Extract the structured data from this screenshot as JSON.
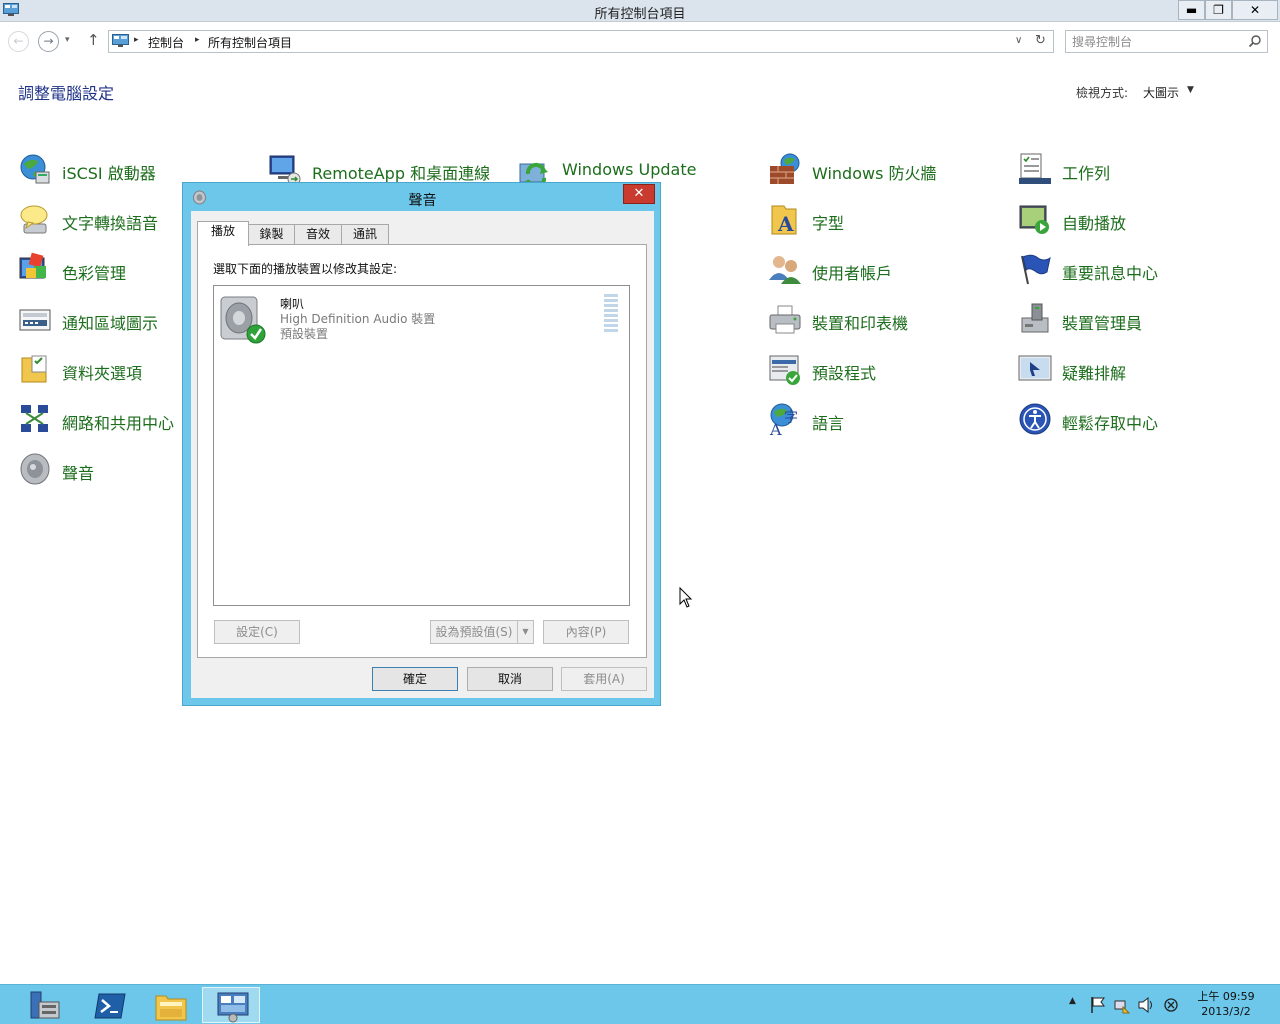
{
  "window": {
    "title": "所有控制台項目",
    "min_glyph": "▬",
    "max_glyph": "❐",
    "close_glyph": "✕"
  },
  "nav": {
    "back_glyph": "←",
    "forward_glyph": "→",
    "recent_glyph": "▾",
    "up_glyph": "↑",
    "breadcrumbs": [
      "控制台",
      "所有控制台項目"
    ],
    "crumb_sep": "▸",
    "dropdown_glyph": "∨",
    "refresh_glyph": "↻",
    "search_placeholder": "搜尋控制台"
  },
  "header": {
    "title": "調整電腦設定",
    "view_label": "檢視方式:",
    "view_value": "大圖示",
    "view_arrow": "▼"
  },
  "items": [
    {
      "label": "iSCSI 啟動器",
      "icon": "iscsi-globe-icon"
    },
    {
      "label": "RemoteApp 和桌面連線",
      "icon": "remoteapp-icon"
    },
    {
      "label": "Windows Update",
      "icon": "windows-update-icon"
    },
    {
      "label": "Windows 防火牆",
      "icon": "firewall-icon"
    },
    {
      "label": "工作列",
      "icon": "taskbar-icon"
    },
    {
      "label": "文字轉換語音",
      "icon": "speech-bubble-icon"
    },
    {
      "label": "字型",
      "icon": "font-folder-icon"
    },
    {
      "label": "自動播放",
      "icon": "autoplay-icon"
    },
    {
      "label": "色彩管理",
      "icon": "color-management-icon"
    },
    {
      "label": "使用者帳戶",
      "icon": "user-accounts-icon"
    },
    {
      "label": "重要訊息中心",
      "icon": "action-center-flag-icon"
    },
    {
      "label": "通知區域圖示",
      "icon": "notification-area-icon"
    },
    {
      "label": "裝置和印表機",
      "icon": "printer-icon"
    },
    {
      "label": "裝置管理員",
      "icon": "device-manager-icon"
    },
    {
      "label": "資料夾選項",
      "icon": "folder-options-icon"
    },
    {
      "label": "預設程式",
      "icon": "default-programs-icon"
    },
    {
      "label": "疑難排解",
      "icon": "troubleshooting-icon"
    },
    {
      "label": "網路和共用中心",
      "icon": "network-icon"
    },
    {
      "label": "語言",
      "icon": "language-icon"
    },
    {
      "label": "輕鬆存取中心",
      "icon": "ease-of-access-icon"
    },
    {
      "label": "聲音",
      "icon": "speaker-icon"
    }
  ],
  "dialog": {
    "title": "聲音",
    "close_glyph": "✕",
    "tabs": [
      "播放",
      "錄製",
      "音效",
      "通訊"
    ],
    "active_tab": "播放",
    "instruction": "選取下面的播放裝置以修改其設定:",
    "device": {
      "name": "喇叭",
      "description": "High Definition Audio 裝置",
      "status": "預設裝置"
    },
    "buttons": {
      "configure": "設定(C)",
      "set_default": "設為預設值(S)",
      "split_arrow": "▼",
      "properties": "內容(P)",
      "ok": "確定",
      "cancel": "取消",
      "apply": "套用(A)"
    }
  },
  "taskbar": {
    "apps": [
      "server-manager-icon",
      "powershell-icon",
      "file-explorer-icon",
      "control-panel-icon"
    ],
    "active_app": "control-panel-icon",
    "show_hidden_glyph": "▲",
    "clock_time": "上午 09:59",
    "clock_date": "2013/3/2"
  },
  "colors": {
    "link_green": "#1c6d1c",
    "title_blue": "#1e3287",
    "dialog_frame": "#6cc7ea",
    "taskbar": "#6cc7ea",
    "close_red": "#c93a2f"
  }
}
